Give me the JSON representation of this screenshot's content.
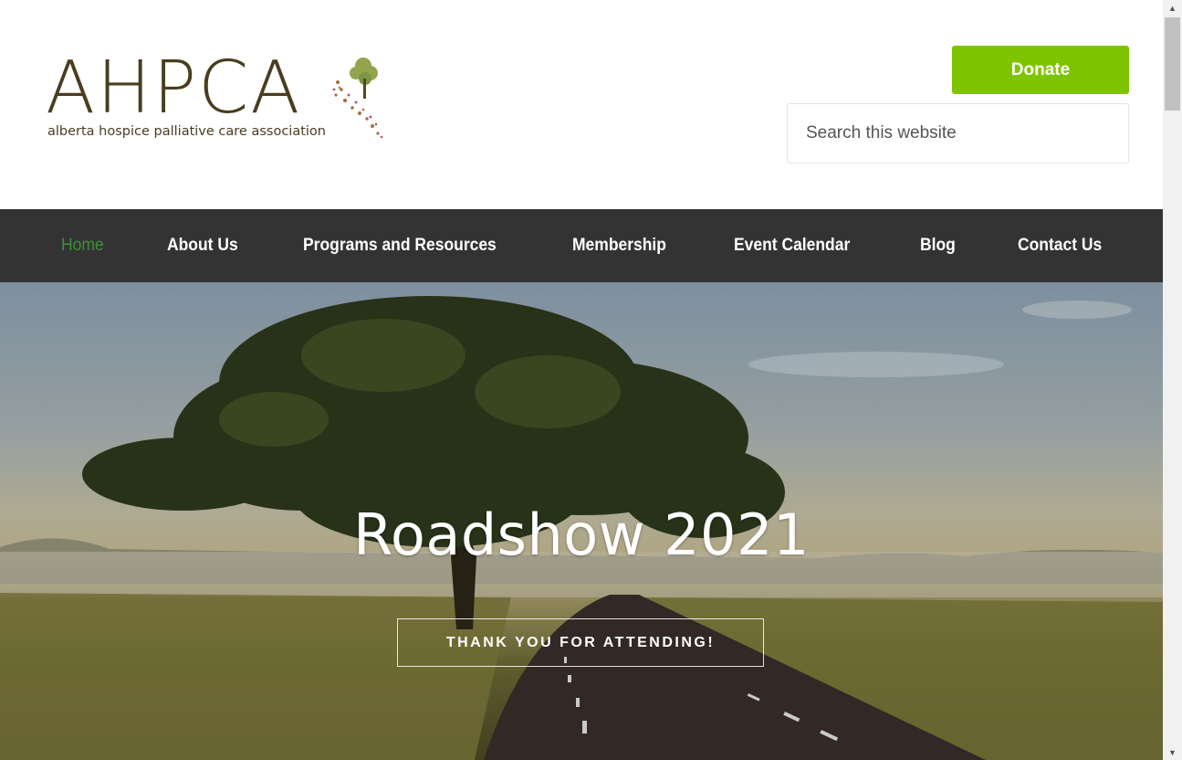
{
  "brand": {
    "logo_text": "AHPCA",
    "tagline": "alberta hospice palliative care association",
    "accent_green": "#7fc400",
    "logo_brown": "#4a3d1f"
  },
  "header": {
    "donate_label": "Donate",
    "search_placeholder": "Search this website"
  },
  "nav": {
    "items": [
      {
        "label": "Home",
        "active": true
      },
      {
        "label": "About Us"
      },
      {
        "label": "Programs and Resources"
      },
      {
        "label": "Membership"
      },
      {
        "label": "Event Calendar"
      },
      {
        "label": "Blog"
      },
      {
        "label": "Contact Us"
      }
    ],
    "background": "#333333",
    "active_color": "#3f8f3a"
  },
  "hero": {
    "title": "Roadshow 2021",
    "button_label": "THANK YOU FOR ATTENDING!"
  },
  "icons": {
    "scroll_up": "scroll-up-arrow-icon",
    "scroll_down": "scroll-down-arrow-icon"
  }
}
